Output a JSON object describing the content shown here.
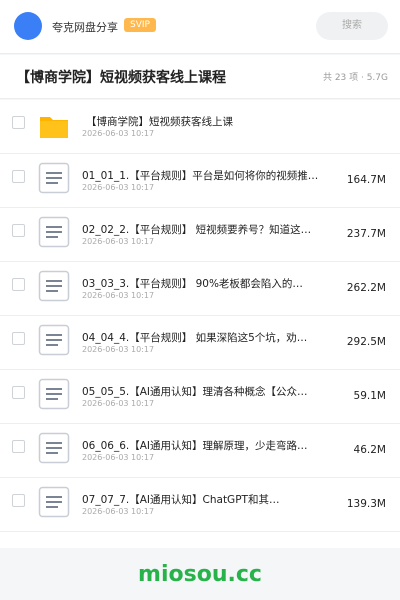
{
  "header": {
    "share_title": "夸克网盘分享",
    "vip_badge": "SVIP",
    "search_placeholder": "搜索"
  },
  "folder": {
    "title": "【博商学院】短视频获客线上课程",
    "meta": "共 23 项 · 5.7G"
  },
  "files": [
    {
      "type": "folder",
      "name": "【博商学院】短视频获客线上课",
      "date": "2026-06-03 10:17",
      "size": ""
    },
    {
      "type": "doc",
      "name": "01_01_1.【平台规则】平台是如何将你的视频推…",
      "date": "2026-06-03 10:17",
      "size": "164.7M"
    },
    {
      "type": "doc",
      "name": "02_02_2.【平台规则】 短视频要养号？知道这…",
      "date": "2026-06-03 10:17",
      "size": "237.7M"
    },
    {
      "type": "doc",
      "name": "03_03_3.【平台规则】 90%老板都会陷入的…",
      "date": "2026-06-03 10:17",
      "size": "262.2M"
    },
    {
      "type": "doc",
      "name": "04_04_4.【平台规则】 如果深陷这5个坑，劝…",
      "date": "2026-06-03 10:17",
      "size": "292.5M"
    },
    {
      "type": "doc",
      "name": "05_05_5.【AI通用认知】理清各种概念【公众…",
      "date": "2026-06-03 10:17",
      "size": "59.1M"
    },
    {
      "type": "doc",
      "name": "06_06_6.【AI通用认知】理解原理，少走弯路…",
      "date": "2026-06-03 10:17",
      "size": "46.2M"
    },
    {
      "type": "doc",
      "name": "07_07_7.【AI通用认知】ChatGPT和其…",
      "date": "2026-06-03 10:17",
      "size": "139.3M"
    }
  ],
  "watermark": "miosou.cc",
  "colors": {
    "accent": "#3a7ff6",
    "vip": "#ffb84d",
    "folder": "#ffc21a",
    "watermark": "#27b24a"
  }
}
